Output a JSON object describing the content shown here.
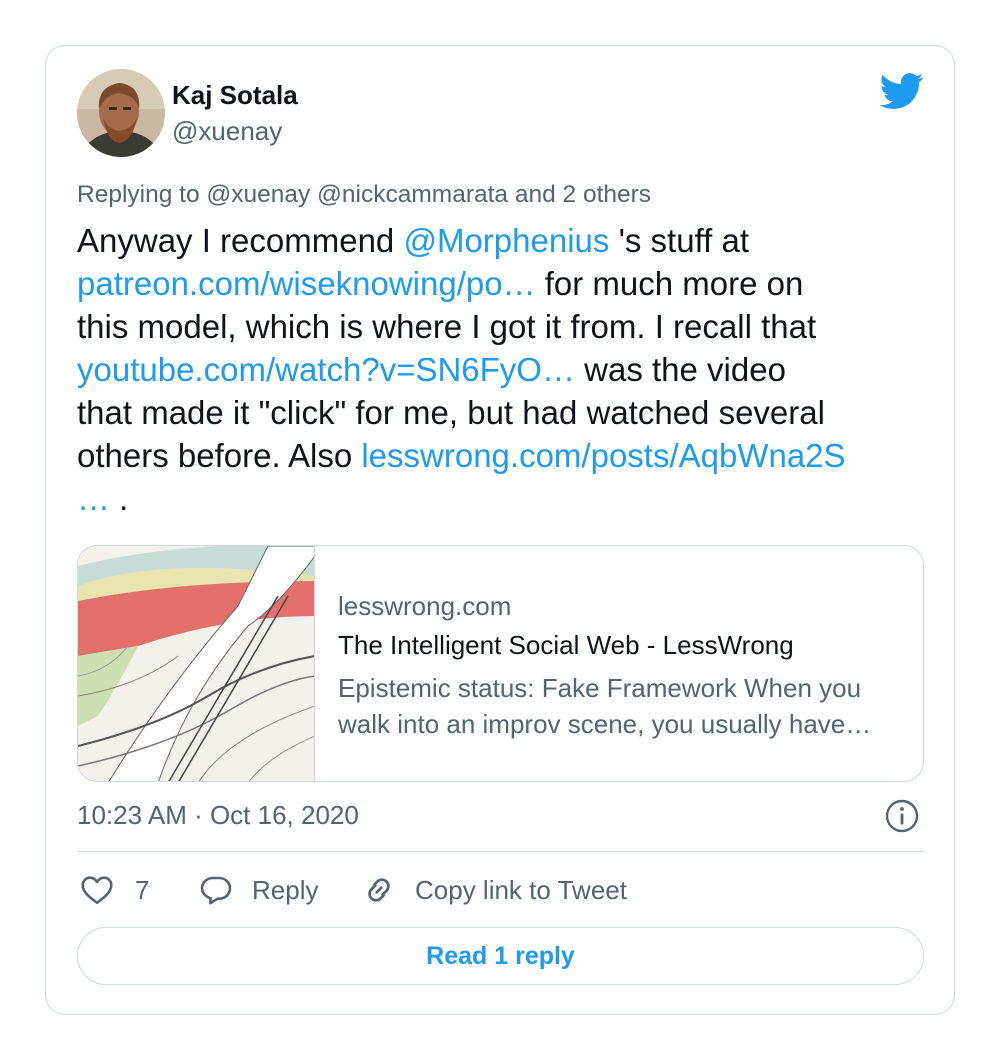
{
  "author": {
    "display_name": "Kaj Sotala",
    "handle": "@xuenay",
    "avatar_icon": "profile-photo",
    "logo_icon": "twitter-bird-icon"
  },
  "tweet": {
    "replying_to": "Replying to @xuenay @nickcammarata and 2 others",
    "text_lines": [
      [
        {
          "text": "Anyway I recommend ",
          "link": false
        },
        {
          "text": "@Morphenius",
          "link": true
        },
        {
          "text": " 's stuff at",
          "link": false
        }
      ],
      [
        {
          "text": "patreon.com/wiseknowing/po…",
          "link": true
        },
        {
          "text": " for much more on",
          "link": false
        }
      ],
      [
        {
          "text": "this model, which is where I got it from. I recall that",
          "link": false
        }
      ],
      [
        {
          "text": "youtube.com/watch?v=SN6FyO…",
          "link": true
        },
        {
          "text": " was the video",
          "link": false
        }
      ],
      [
        {
          "text": "that made it \"click\" for me, but had watched several",
          "link": false
        }
      ],
      [
        {
          "text": "others before. Also ",
          "link": false
        },
        {
          "text": "lesswrong.com/posts/AqbWna2S",
          "link": true
        }
      ],
      [
        {
          "text": "…",
          "link": true
        },
        {
          "text": " .",
          "link": false
        }
      ]
    ]
  },
  "link_card": {
    "domain": "lesswrong.com",
    "title": "The Intelligent Social Web - LessWrong",
    "description_lines": [
      "Epistemic status: Fake Framework When you",
      "walk into an improv scene, you usually have…"
    ]
  },
  "meta": {
    "timestamp": "10:23 AM · Oct 16, 2020",
    "info_icon": "info-icon"
  },
  "actions": {
    "like_count": "7",
    "reply_label": "Reply",
    "copy_label": "Copy link to Tweet"
  },
  "read_replies_label": "Read 1 reply",
  "colors": {
    "accent": "#1d9bf0",
    "text_primary": "#0f1419",
    "text_secondary": "#536471",
    "border": "#cfd9de"
  }
}
